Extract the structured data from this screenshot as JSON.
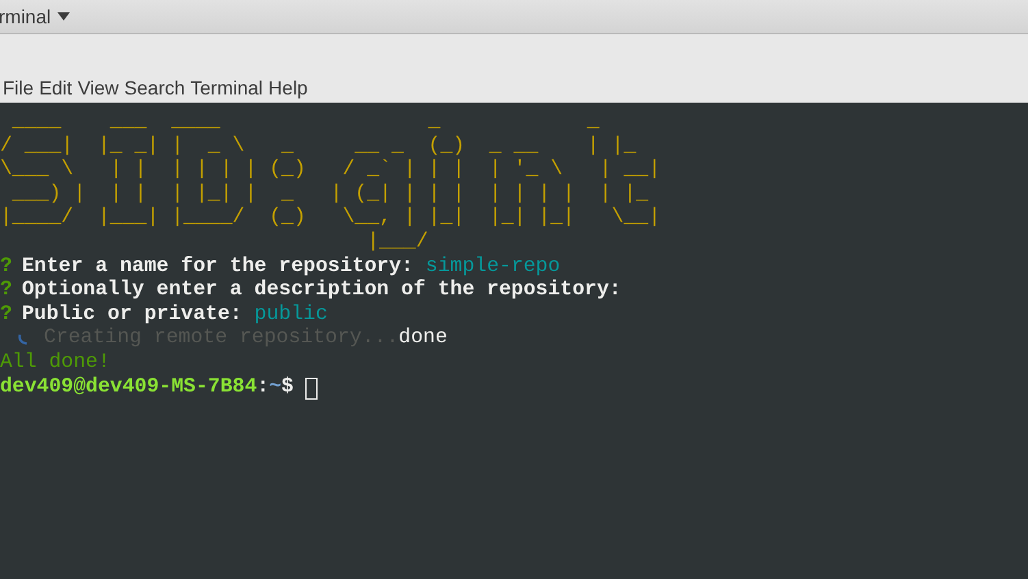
{
  "window": {
    "title": "rminal"
  },
  "menu": [
    "File",
    "Edit",
    "View",
    "Search",
    "Terminal",
    "Help"
  ],
  "terminal": {
    "banner": [
      " ____    ___  ____                 _            _",
      "/ ___|  |_ _| |  _ \\   _     __ _  (_)  _ __    | |_  ",
      "\\___ \\   | |  | | | | (_)   / _` | | |  | '_ \\   | __| ",
      " ___) |  | |  | |_| |  _   | (_| | | |  | | | |  | |_  ",
      "|____/  |___| |____/  (_)   \\__, | |_|  |_| |_|   \\__| ",
      "                              |___/                     "
    ],
    "lines": [
      {
        "kind": "question",
        "mark": "?",
        "text": "Enter a name for the repository:",
        "answer": "simple-repo"
      },
      {
        "kind": "question",
        "mark": "?",
        "text": "Optionally enter a description of the repository:"
      },
      {
        "kind": "question",
        "mark": "?",
        "text": "Public or private:",
        "answer": "public"
      },
      {
        "kind": "spinner",
        "text": "Creating remote repository...",
        "status": "done"
      },
      {
        "kind": "success",
        "text": "All done!"
      },
      {
        "kind": "prompt",
        "user_host": "dev409@dev409-MS-7B84",
        "separator": ":",
        "path": "~",
        "symbol": "$",
        "cursor": true
      }
    ]
  }
}
